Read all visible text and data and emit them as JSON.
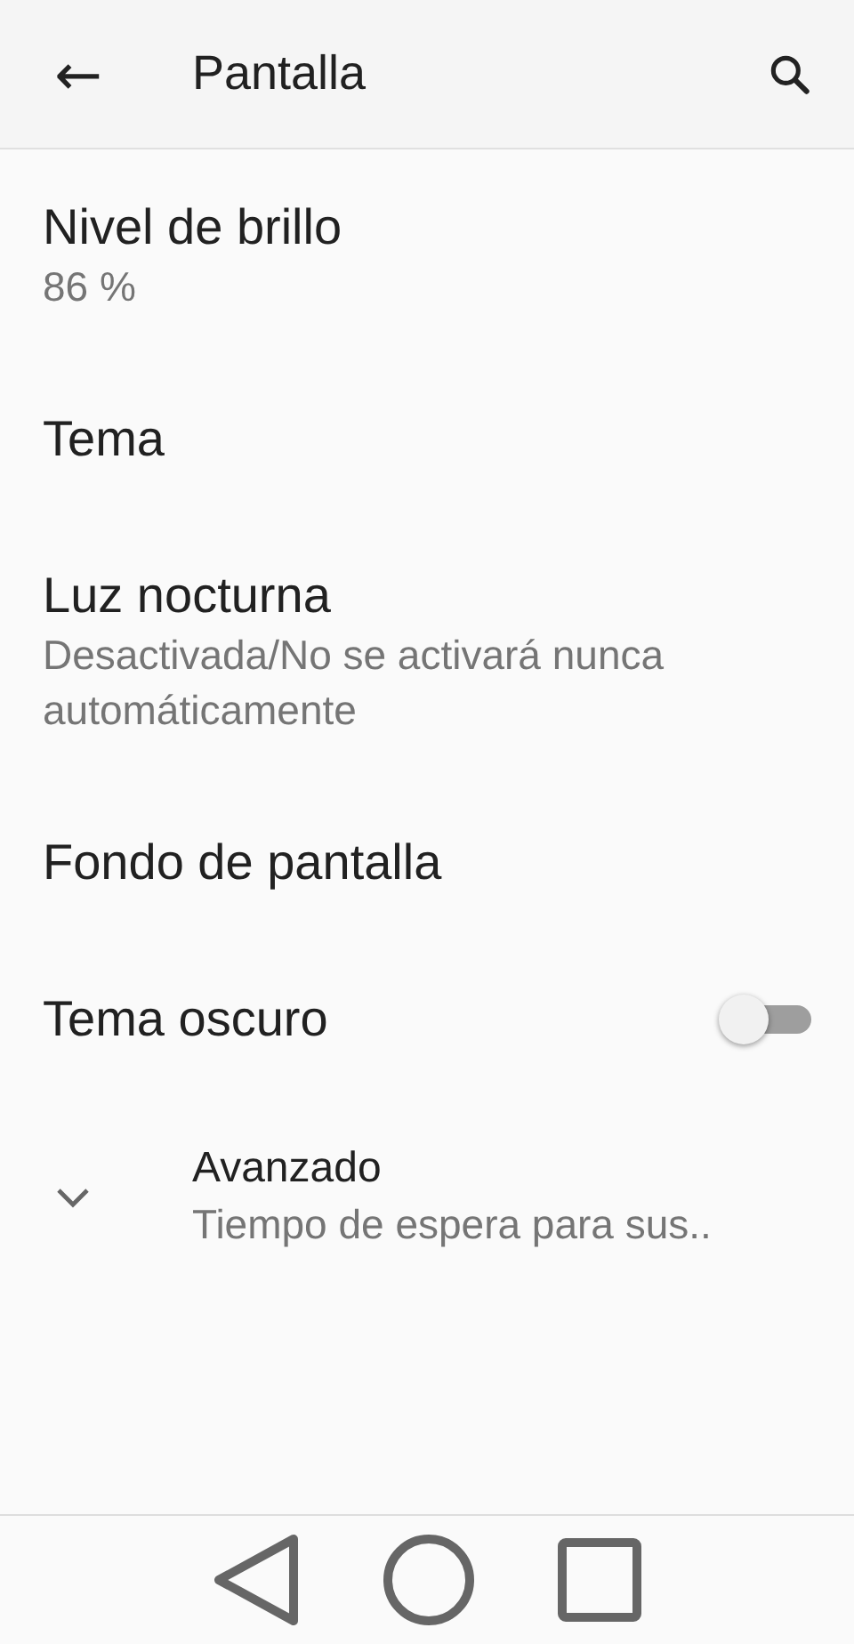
{
  "header": {
    "back": "←",
    "title": "Pantalla"
  },
  "items": [
    {
      "kind": "text",
      "title": "Nivel de brillo",
      "summary": "86 %"
    },
    {
      "kind": "text",
      "title": "Tema"
    },
    {
      "kind": "text",
      "title": "Luz nocturna",
      "summary": "Desactivada/No se activará nunca automáticamente"
    },
    {
      "kind": "text",
      "title": "Fondo de pantalla"
    },
    {
      "kind": "switch",
      "title": "Tema oscuro",
      "on": false
    },
    {
      "kind": "expand",
      "title": "Avanzado",
      "summary": "Tiempo de espera para sus..",
      "expanded": false
    }
  ]
}
